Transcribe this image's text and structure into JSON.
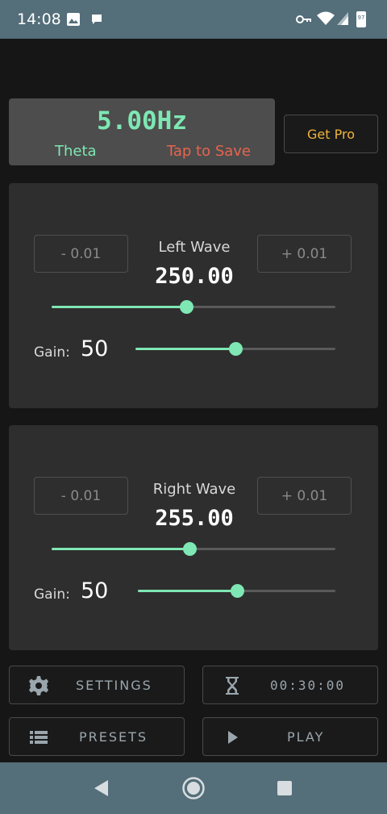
{
  "status_bar": {
    "time": "14:08",
    "battery_level": "97",
    "left_icons": [
      "image-icon",
      "chat-bubble-icon"
    ],
    "right_icons": [
      "vpn-key-icon",
      "wifi-icon",
      "cellular-signal-icon",
      "battery-icon"
    ]
  },
  "beat": {
    "frequency": "5.00Hz",
    "band": "Theta",
    "save_label": "Tap to Save"
  },
  "get_pro_label": "Get Pro",
  "left_wave": {
    "title": "Left Wave",
    "value": "250.00",
    "minus_label": "- 0.01",
    "plus_label": "+ 0.01",
    "frequency_slider_level": 0.474,
    "gain_label": "Gain:",
    "gain_value": "50",
    "gain_slider_level": 0.5
  },
  "right_wave": {
    "title": "Right Wave",
    "value": "255.00",
    "minus_label": "- 0.01",
    "plus_label": "+ 0.01",
    "frequency_slider_level": 0.486,
    "gain_label": "Gain:",
    "gain_value": "50",
    "gain_slider_level": 0.5
  },
  "controls": {
    "settings_label": "SETTINGS",
    "timer_label": "00:30:00",
    "presets_label": "PRESETS",
    "play_label": "PLAY"
  },
  "colors": {
    "accent": "#7ee7b3",
    "save": "#e7644e",
    "pro": "#f0b43c",
    "status_bar": "#546e7a"
  }
}
